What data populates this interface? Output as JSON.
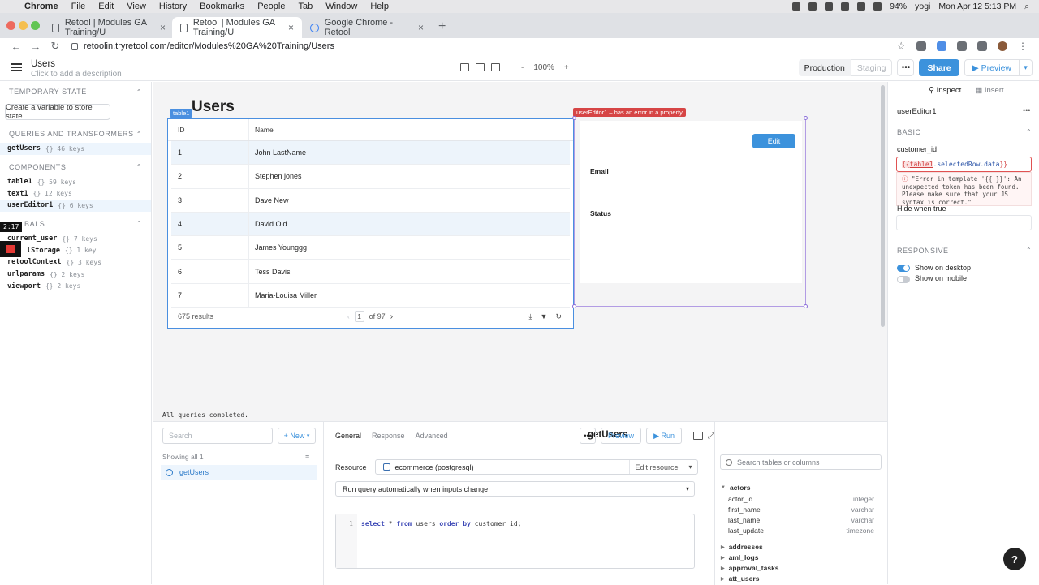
{
  "menubar": {
    "app": "Chrome",
    "items": [
      "File",
      "Edit",
      "View",
      "History",
      "Bookmarks",
      "People",
      "Tab",
      "Window",
      "Help"
    ],
    "battery": "94%",
    "user": "yogi",
    "datetime": "Mon Apr 12  5:13 PM"
  },
  "browser": {
    "tabs": [
      {
        "title": "Retool | Modules GA Training/U"
      },
      {
        "title": "Retool | Modules GA Training/U"
      },
      {
        "title": "Google Chrome - Retool"
      }
    ],
    "url": "retoolin.tryretool.com/editor/Modules%20GA%20Training/Users"
  },
  "header": {
    "app_name": "Users",
    "description": "Click to add a description",
    "zoom": "100%",
    "zoom_minus": "-",
    "zoom_plus": "+",
    "production": "Production",
    "staging": "Staging",
    "share": "Share",
    "preview": "Preview"
  },
  "left": {
    "temp_state_title": "TEMPORARY STATE",
    "create_var_label": "Create a variable to store state",
    "queries_title": "QUERIES AND TRANSFORMERS",
    "queries": [
      {
        "name": "getUsers",
        "meta": "{} 46 keys"
      }
    ],
    "components_title": "COMPONENTS",
    "components": [
      {
        "name": "table1",
        "meta": "{} 59 keys"
      },
      {
        "name": "text1",
        "meta": "{} 12 keys"
      },
      {
        "name": "userEditor1",
        "meta": "{} 6 keys"
      }
    ],
    "globals_title": "GLOBALS",
    "globals_visible_title": "BALS",
    "globals": [
      {
        "name": "current_user",
        "visible": "current_user",
        "meta": "{} 7 keys"
      },
      {
        "name": "localStorage",
        "visible": "lStorage",
        "meta": "{} 1 key"
      },
      {
        "name": "retoolContext",
        "visible": "retoolContext",
        "meta": "{} 3 keys"
      },
      {
        "name": "urlparams",
        "visible": "urlparams",
        "meta": "{} 2 keys"
      },
      {
        "name": "viewport",
        "visible": "viewport",
        "meta": "{} 2 keys"
      }
    ],
    "recording_time": "2:17"
  },
  "canvas": {
    "page_title": "Users",
    "table_tag": "table1",
    "table": {
      "columns": [
        "ID",
        "Name"
      ],
      "rows": [
        [
          "1",
          "John LastName"
        ],
        [
          "2",
          "Stephen jones"
        ],
        [
          "3",
          "Dave New"
        ],
        [
          "4",
          "David Old"
        ],
        [
          "5",
          "James Younggg"
        ],
        [
          "6",
          "Tess Davis"
        ],
        [
          "7",
          "Maria-Louisa Miller"
        ]
      ],
      "results": "675 results",
      "page": "1",
      "of_pages": "of 97"
    },
    "editor_tag": "userEditor1 – has an error in a property",
    "edit_label": "Edit",
    "email_label": "Email",
    "status_label": "Status"
  },
  "queries": {
    "status": "All queries completed.",
    "search_placeholder": "Search",
    "new_label": "+ New",
    "showing": "Showing all 1",
    "selected_query": "getUsers",
    "tabs": [
      "General",
      "Response",
      "Advanced"
    ],
    "title": "getUsers",
    "preview": "Preview",
    "run": "Run",
    "resource_label": "Resource",
    "resource_value": "ecommerce (postgresql)",
    "edit_resource": "Edit resource",
    "run_mode": "Run query automatically when inputs change",
    "code_line_no": "1",
    "code": {
      "kw1": "select",
      "mid1": " * ",
      "kw2": "from",
      "mid2": " users ",
      "kw3": "order by",
      "mid3": " customer_id;"
    },
    "schema_search": "Search tables or columns",
    "schema": {
      "tables_expanded": "actors",
      "columns": [
        {
          "name": "actor_id",
          "type": "integer"
        },
        {
          "name": "first_name",
          "type": "varchar"
        },
        {
          "name": "last_name",
          "type": "varchar"
        },
        {
          "name": "last_update",
          "type": "timezone"
        }
      ],
      "other_tables": [
        "addresses",
        "aml_logs",
        "approval_tasks",
        "att_users"
      ]
    }
  },
  "right": {
    "tab_inspect": "Inspect",
    "tab_insert": "Insert",
    "component_name": "userEditor1",
    "basic_title": "BASIC",
    "customer_id_label": "customer_id",
    "customer_id_value": {
      "open": "{{ ",
      "ref": "table1",
      "rest": ".selectedRow.data",
      "close": "}}"
    },
    "error_text": "\"Error in template '{{ }}': An unexpected token has been found. Please make sure that your JS syntax is correct.\"",
    "hide_label": "Hide when true",
    "responsive_title": "RESPONSIVE",
    "show_desktop": "Show on desktop",
    "show_mobile": "Show on mobile",
    "show_desktop_on": true,
    "show_mobile_on": false
  },
  "colors": {
    "accent": "#3c92dc",
    "error": "#e05252",
    "selection": "#4a8fe0",
    "editor_outline": "#b29ce4"
  }
}
